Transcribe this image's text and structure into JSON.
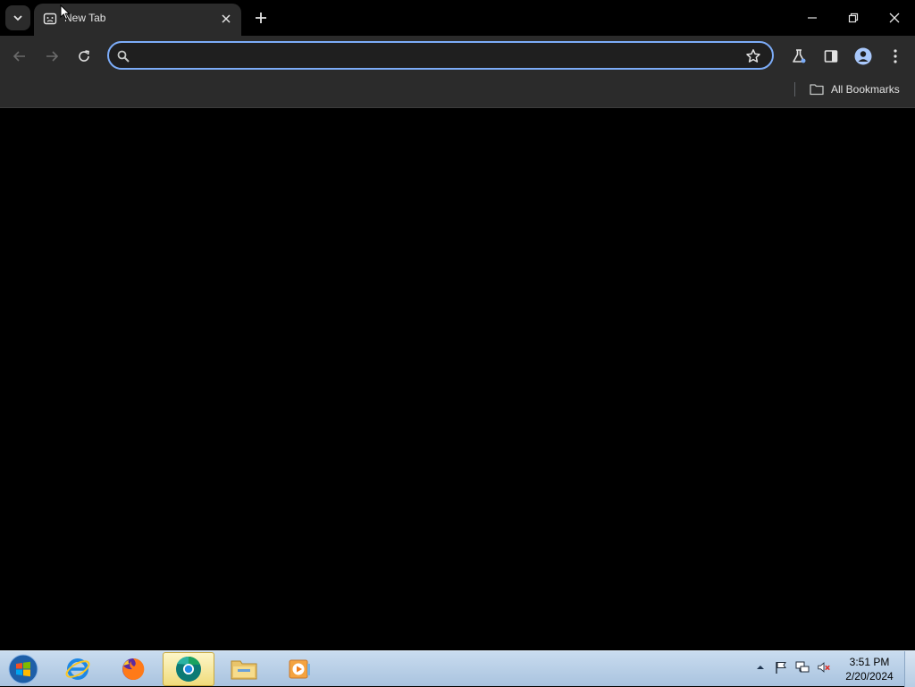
{
  "browser": {
    "tab": {
      "title": "New Tab"
    },
    "omnibox": {
      "value": "",
      "placeholder": ""
    },
    "bookmarks": {
      "all_bookmarks_label": "All Bookmarks"
    },
    "accent_color": "#7cacf8"
  },
  "taskbar": {
    "apps": [
      {
        "name": "Internet Explorer",
        "icon": "internet-explorer-icon"
      },
      {
        "name": "Firefox",
        "icon": "firefox-icon"
      },
      {
        "name": "Chrome",
        "icon": "chrome-icon",
        "active": true
      },
      {
        "name": "File Explorer",
        "icon": "folder-icon"
      },
      {
        "name": "Media Player",
        "icon": "media-player-icon"
      }
    ],
    "clock": {
      "time": "3:51 PM",
      "date": "2/20/2024"
    }
  }
}
